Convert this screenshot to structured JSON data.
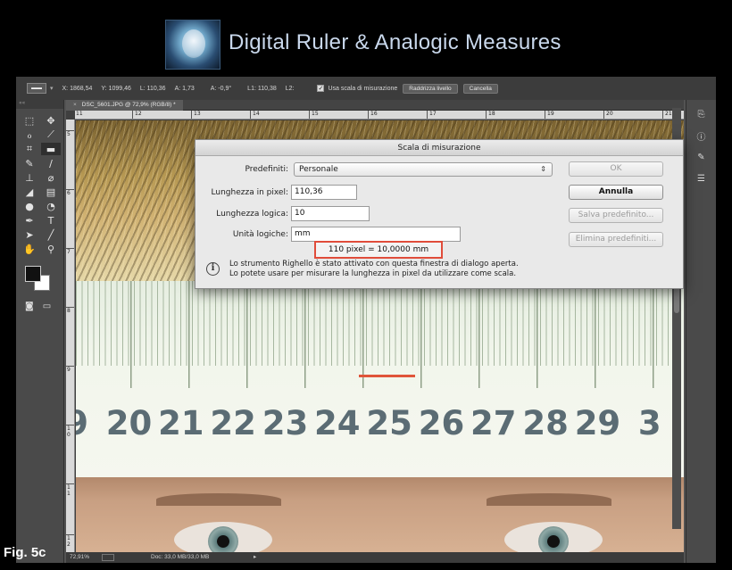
{
  "banner": {
    "title": "Digital Ruler & Analogic Measures",
    "logo_icon": "portrait-logo-icon"
  },
  "options_bar": {
    "tool_label": "▬▬",
    "x": "X: 1868,54",
    "y": "Y: 1099,46",
    "l": "L: 110,36",
    "a": "A: 1,73",
    "angle": "A: -0,9°",
    "l1": "L1: 110,38",
    "l2": "L2:",
    "use_scale_label": "Usa scala di misurazione",
    "straighten_label": "Raddrizza livello",
    "clear_label": "Cancella"
  },
  "document": {
    "tab_title": "DSC_5601.JPG @ 72,9% (RGB/8) *",
    "hruler_ticks": [
      "11",
      "12",
      "13",
      "14",
      "15",
      "16",
      "17",
      "18",
      "19",
      "20",
      "21"
    ],
    "vruler_ticks": [
      "5",
      "6",
      "7",
      "8",
      "9",
      "1 0",
      "1 1",
      "1 2"
    ],
    "ruler_numbers": [
      "9",
      "20",
      "21",
      "22",
      "23",
      "24",
      "25",
      "26",
      "27",
      "28",
      "29",
      "3"
    ]
  },
  "status_bar": {
    "zoom": "72,91%",
    "doc_info": "Doc: 33,0 MB/33,0 MB"
  },
  "dialog": {
    "title": "Scala di misurazione",
    "preset_label": "Predefiniti:",
    "preset_value": "Personale",
    "pixel_length_label": "Lunghezza in pixel:",
    "pixel_length_value": "110,36",
    "logical_length_label": "Lunghezza logica:",
    "logical_length_value": "10",
    "logical_units_label": "Unità logiche:",
    "logical_units_value": "mm",
    "result": "110 pixel = 10,0000 mm",
    "info_line1": "Lo strumento Righello è stato attivato con questa finestra di dialogo aperta.",
    "info_line2": "Lo potete usare per misurare la lunghezza in pixel da utilizzare come scala.",
    "ok_label": "OK",
    "cancel_label": "Annulla",
    "save_preset_label": "Salva predefinito...",
    "delete_preset_label": "Elimina predefiniti..."
  },
  "figure_label": "Fig. 5c"
}
